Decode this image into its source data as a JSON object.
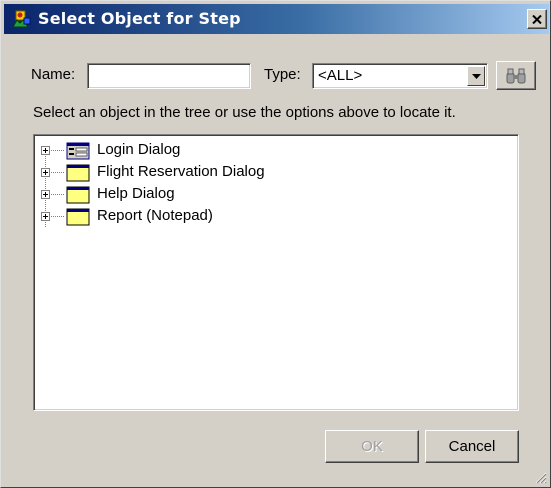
{
  "dialog": {
    "title": "Select Object for Step",
    "close_label": "×"
  },
  "filters": {
    "name_label": "Name:",
    "name_value": "",
    "name_placeholder": "",
    "type_label": "Type:",
    "type_value": "<ALL>"
  },
  "instruction": "Select an object in the tree or use the options above to locate it.",
  "tree": {
    "items": [
      {
        "label": "Login Dialog",
        "icon": "dialog-form-icon",
        "expanded": false
      },
      {
        "label": "Flight Reservation Dialog",
        "icon": "window-icon",
        "expanded": false
      },
      {
        "label": "Help Dialog",
        "icon": "window-icon",
        "expanded": false
      },
      {
        "label": "Report (Notepad)",
        "icon": "window-icon",
        "expanded": false
      }
    ]
  },
  "buttons": {
    "ok_label": "OK",
    "ok_enabled": false,
    "cancel_label": "Cancel"
  },
  "colors": {
    "title_start": "#0a246a",
    "title_end": "#a6caf0",
    "face": "#d4d0c8",
    "window_icon_fill": "#ffff80"
  }
}
